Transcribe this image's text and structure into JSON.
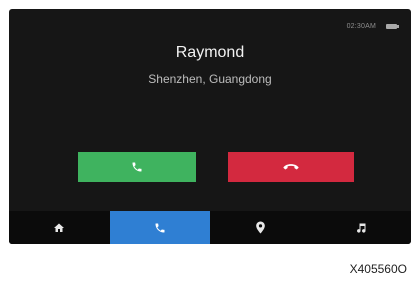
{
  "status_bar": {
    "time": "02:30AM",
    "battery_icon": "battery-icon"
  },
  "caller": {
    "name": "Raymond",
    "location": "Shenzhen, Guangdong"
  },
  "actions": {
    "answer_icon": "phone-icon",
    "answer_color": "#3fb35f",
    "decline_icon": "phone-hangup-icon",
    "decline_color": "#d3293f"
  },
  "nav": {
    "items": [
      {
        "icon": "home-icon",
        "active": false
      },
      {
        "icon": "phone-icon",
        "active": true
      },
      {
        "icon": "map-pin-icon",
        "active": false
      },
      {
        "icon": "music-note-icon",
        "active": false
      }
    ],
    "active_color": "#2f7fd3"
  },
  "footer": {
    "model_code": "X405560O"
  }
}
